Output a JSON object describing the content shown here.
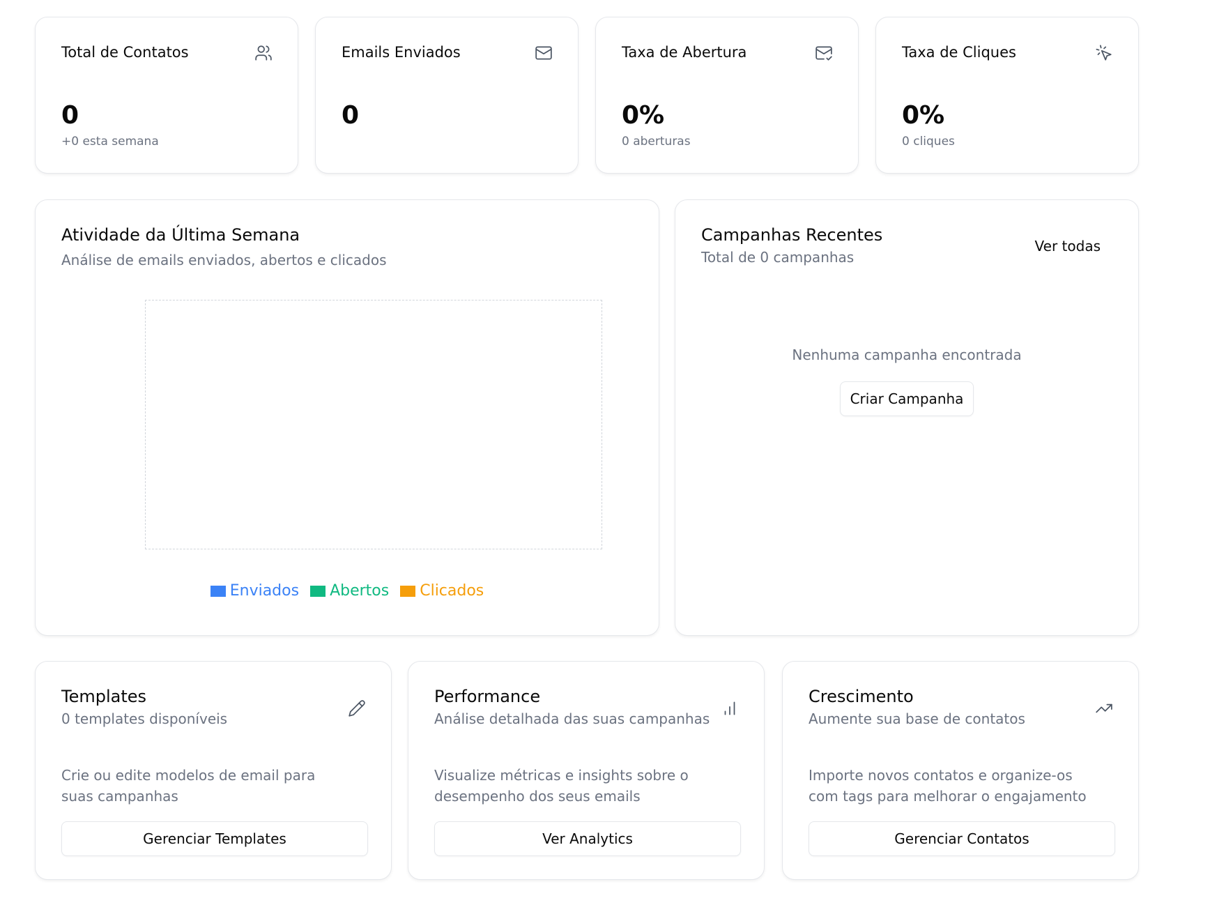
{
  "stats": [
    {
      "title": "Total de Contatos",
      "value": "0",
      "sub": "+0 esta semana",
      "icon": "users-icon"
    },
    {
      "title": "Emails Enviados",
      "value": "0",
      "sub": "",
      "icon": "mail-icon"
    },
    {
      "title": "Taxa de Abertura",
      "value": "0%",
      "sub": "0 aberturas",
      "icon": "mail-check-icon"
    },
    {
      "title": "Taxa de Cliques",
      "value": "0%",
      "sub": "0 cliques",
      "icon": "mouse-pointer-click-icon"
    }
  ],
  "activity": {
    "title": "Atividade da Última Semana",
    "subtitle": "Análise de emails enviados, abertos e clicados",
    "legend": [
      {
        "label": "Enviados",
        "color": "#3b82f6"
      },
      {
        "label": "Abertos",
        "color": "#10b981"
      },
      {
        "label": "Clicados",
        "color": "#f59e0b"
      }
    ]
  },
  "campaigns": {
    "title": "Campanhas Recentes",
    "subtitle": "Total de 0 campanhas",
    "view_all": "Ver todas",
    "empty": "Nenhuma campanha encontrada",
    "create_button": "Criar Campanha"
  },
  "bottom_cards": [
    {
      "title": "Templates",
      "subtitle": "0 templates disponíveis",
      "description": "Crie ou edite modelos de email para suas campanhas",
      "button": "Gerenciar Templates",
      "icon": "pencil-icon"
    },
    {
      "title": "Performance",
      "subtitle": "Análise detalhada das suas campanhas",
      "description": "Visualize métricas e insights sobre o desempenho dos seus emails",
      "button": "Ver Analytics",
      "icon": "bar-chart-icon"
    },
    {
      "title": "Crescimento",
      "subtitle": "Aumente sua base de contatos",
      "description": "Importe novos contatos e organize-os com tags para melhorar o engajamento",
      "button": "Gerenciar Contatos",
      "icon": "trending-up-icon"
    }
  ]
}
